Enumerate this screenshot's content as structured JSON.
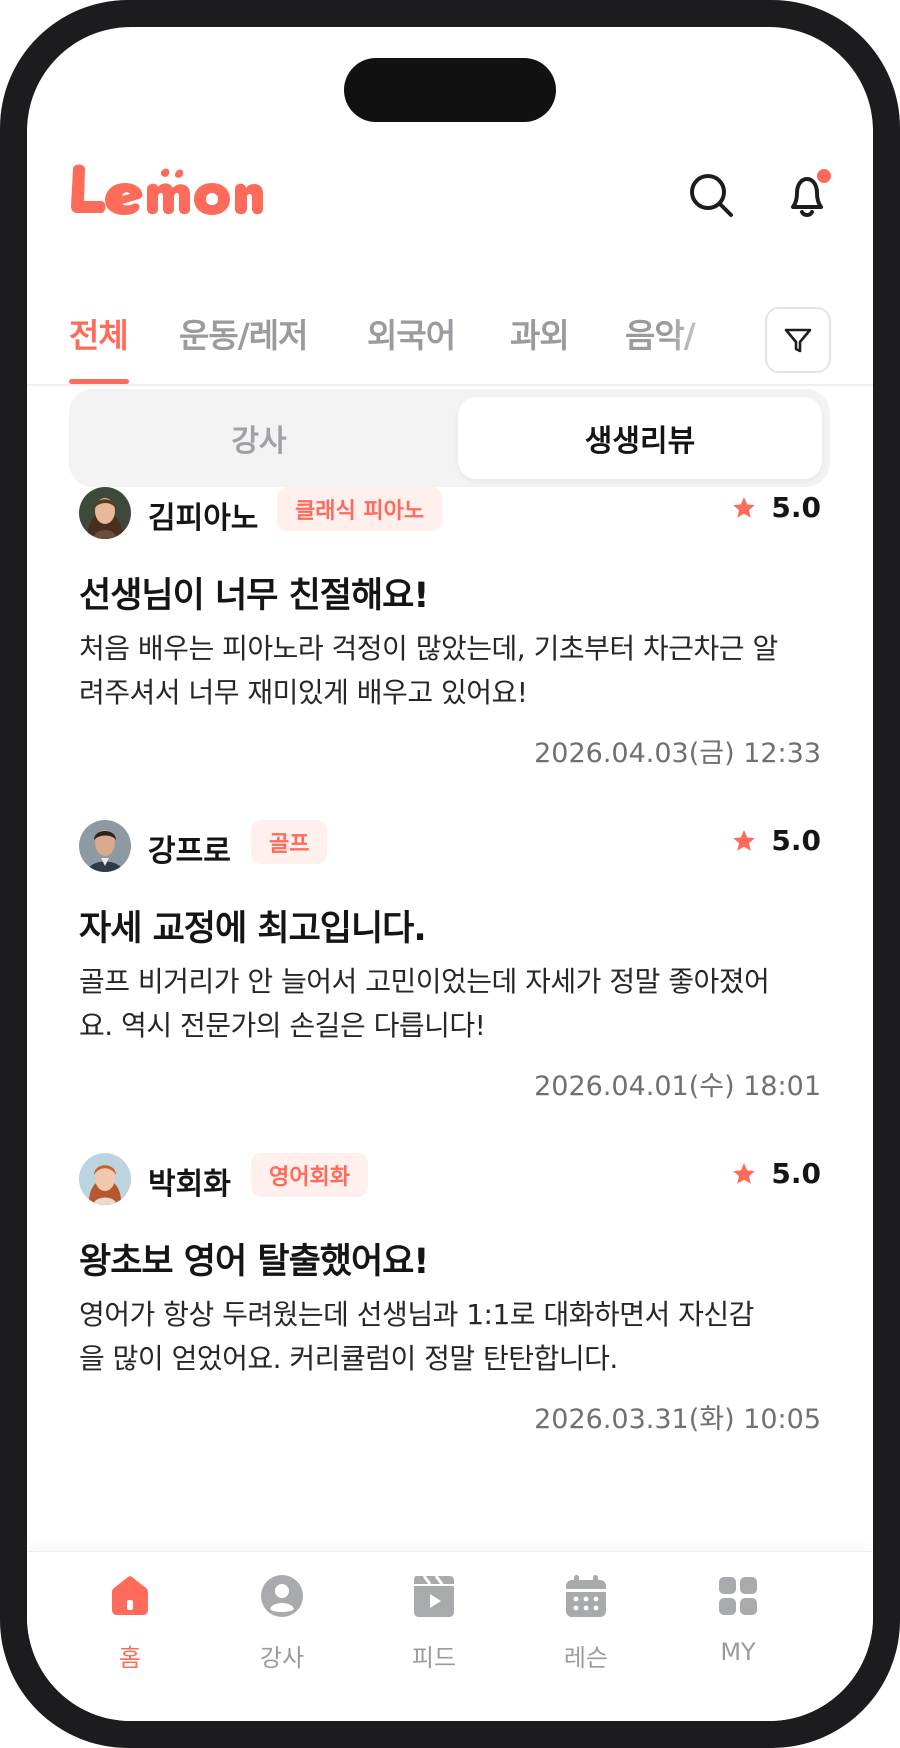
{
  "app": {
    "logo_text": "Lemon",
    "accent_color": "#ff6b5b",
    "notification_dot": true
  },
  "header": {
    "search_icon": "search-icon",
    "bell_icon": "bell-icon"
  },
  "category_tabs": [
    {
      "label": "전체",
      "active": true
    },
    {
      "label": "운동/레저",
      "active": false
    },
    {
      "label": "외국어",
      "active": false
    },
    {
      "label": "과외",
      "active": false
    },
    {
      "label": "음악/",
      "active": false
    }
  ],
  "filter_icon": "filter-icon",
  "segment": {
    "left_label": "강사",
    "right_label": "생생리뷰",
    "selected": "생생리뷰"
  },
  "reviews": [
    {
      "name": "김피아노",
      "category": "클래식 피아노",
      "rating": "5.0",
      "title": "선생님이 너무 친절해요!",
      "body": "처음 배우는 피아노라 걱정이 많았는데, 기초부터 차근차근 알려주셔서 너무 재미있게 배우고 있어요!",
      "date": "2026.04.03(금) 12:33"
    },
    {
      "name": "강프로",
      "category": "골프",
      "rating": "5.0",
      "title": "자세 교정에 최고입니다.",
      "body": "골프 비거리가 안 늘어서 고민이었는데 자세가 정말 좋아졌어요. 역시 전문가의 손길은 다릅니다!",
      "date": "2026.04.01(수) 18:01"
    },
    {
      "name": "박회화",
      "category": "영어회화",
      "rating": "5.0",
      "title": "왕초보 영어 탈출했어요!",
      "body": "영어가 항상 두려웠는데 선생님과 1:1로 대화하면서 자신감을 많이 얻었어요. 커리큘럼이 정말 탄탄합니다.",
      "date": "2026.03.31(화) 10:05"
    }
  ],
  "bottom_nav": [
    {
      "label": "홈",
      "icon": "home-icon",
      "active": true
    },
    {
      "label": "강사",
      "icon": "instructor-icon",
      "active": false
    },
    {
      "label": "피드",
      "icon": "feed-icon",
      "active": false
    },
    {
      "label": "레슨",
      "icon": "calendar-icon",
      "active": false
    },
    {
      "label": "MY",
      "icon": "grid-icon",
      "active": false
    }
  ]
}
